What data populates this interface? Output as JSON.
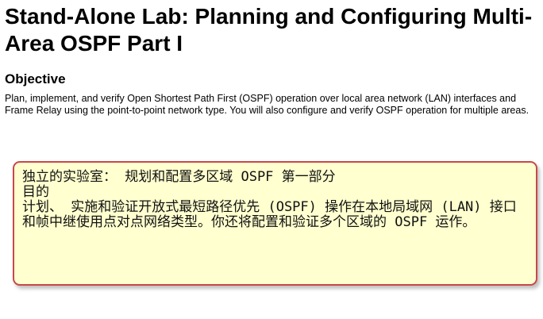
{
  "document": {
    "title": "Stand-Alone Lab: Planning and Configuring Multi-Area OSPF Part I",
    "section_heading": "Objective",
    "objective_text": "Plan, implement, and verify Open Shortest Path First (OSPF) operation over local area network (LAN) interfaces and Frame Relay using the point-to-point network type. You will also configure and verify OSPF operation for multiple areas."
  },
  "translation_callout": {
    "line_title": "独立的实验室： 规划和配置多区域 OSPF 第一部分",
    "line_heading": "目的",
    "line_body": "计划、 实施和验证开放式最短路径优先 (OSPF) 操作在本地局域网 (LAN) 接口和帧中继使用点对点网络类型。你还将配置和验证多个区域的 OSPF 运作。"
  },
  "colors": {
    "callout_background": "#ffffcf",
    "callout_border": "#c9484a"
  }
}
